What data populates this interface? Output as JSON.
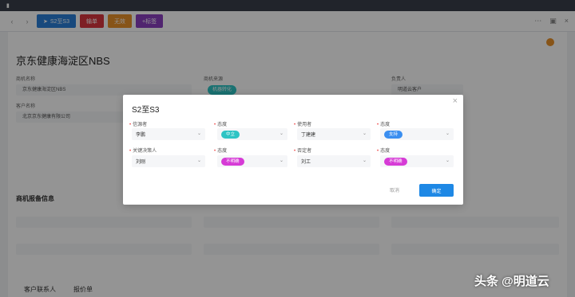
{
  "toolbar": {
    "s2s3_label": "S2至S3",
    "btn2_label": "输单",
    "btn3_label": "无效",
    "btn4_label": "+标签"
  },
  "page": {
    "title": "京东健康海淀区NBS"
  },
  "background_fields": [
    {
      "label": "商机名称",
      "value": "京东健康海淀区NBS"
    },
    {
      "label": "客户名称",
      "value": "北京京东健康有限公司"
    },
    {
      "label": "商机来源",
      "value": "机器转化"
    },
    {
      "label": "负责人",
      "value": "明道云客户"
    }
  ],
  "background_section": {
    "title": "商机报备信息"
  },
  "background_tabs": [
    "客户联系人",
    "报价单"
  ],
  "modal": {
    "title": "S2至S3",
    "close_glyph": "×",
    "fields": [
      {
        "label": "信源者",
        "value": "李鹏"
      },
      {
        "label": "态度",
        "value": "中立",
        "pill": "teal"
      },
      {
        "label": "使用者",
        "value": "丁建建"
      },
      {
        "label": "态度",
        "value": "支持",
        "pill": "blue"
      },
      {
        "label": "关键决策人",
        "value": "刘刚"
      },
      {
        "label": "态度",
        "value": "不明确",
        "pill": "pink"
      },
      {
        "label": "否定者",
        "value": "刘工"
      },
      {
        "label": "态度",
        "value": "不明确",
        "pill": "pink"
      }
    ],
    "cancel_label": "取消",
    "ok_label": "确定"
  },
  "watermark": "头条 @明道云",
  "colors": {
    "primary": "#1e88e5",
    "teal": "#2ec4c4",
    "blue": "#3a8ef0",
    "pink": "#d63bd6"
  }
}
